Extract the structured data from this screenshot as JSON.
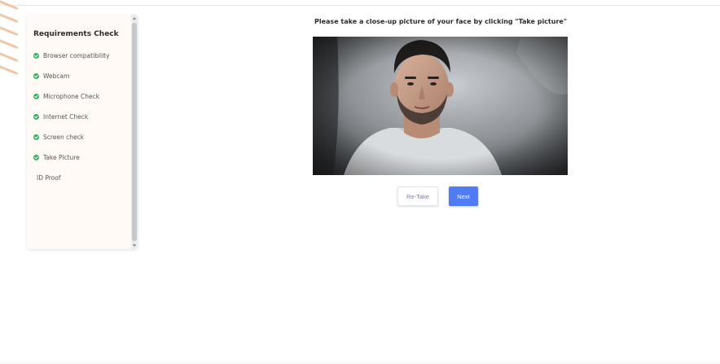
{
  "requirements": {
    "title": "Requirements Check",
    "items": [
      {
        "label": "Browser compatibility",
        "status": "done"
      },
      {
        "label": "Webcam",
        "status": "done"
      },
      {
        "label": "Microphone Check",
        "status": "done"
      },
      {
        "label": "Internet Check",
        "status": "done"
      },
      {
        "label": "Screen check",
        "status": "done"
      },
      {
        "label": "Take Picture",
        "status": "done"
      },
      {
        "label": "ID Proof",
        "status": "pending"
      }
    ]
  },
  "main": {
    "instruction": "Please take a close-up picture of your face by clicking \"Take picture\"",
    "retake_label": "Re-Take",
    "next_label": "Next"
  },
  "colors": {
    "check": "#2fb35d",
    "accent": "#4f7cf5",
    "panel_bg": "#fffaf6"
  },
  "icons": {
    "check": "check-circle-icon"
  }
}
